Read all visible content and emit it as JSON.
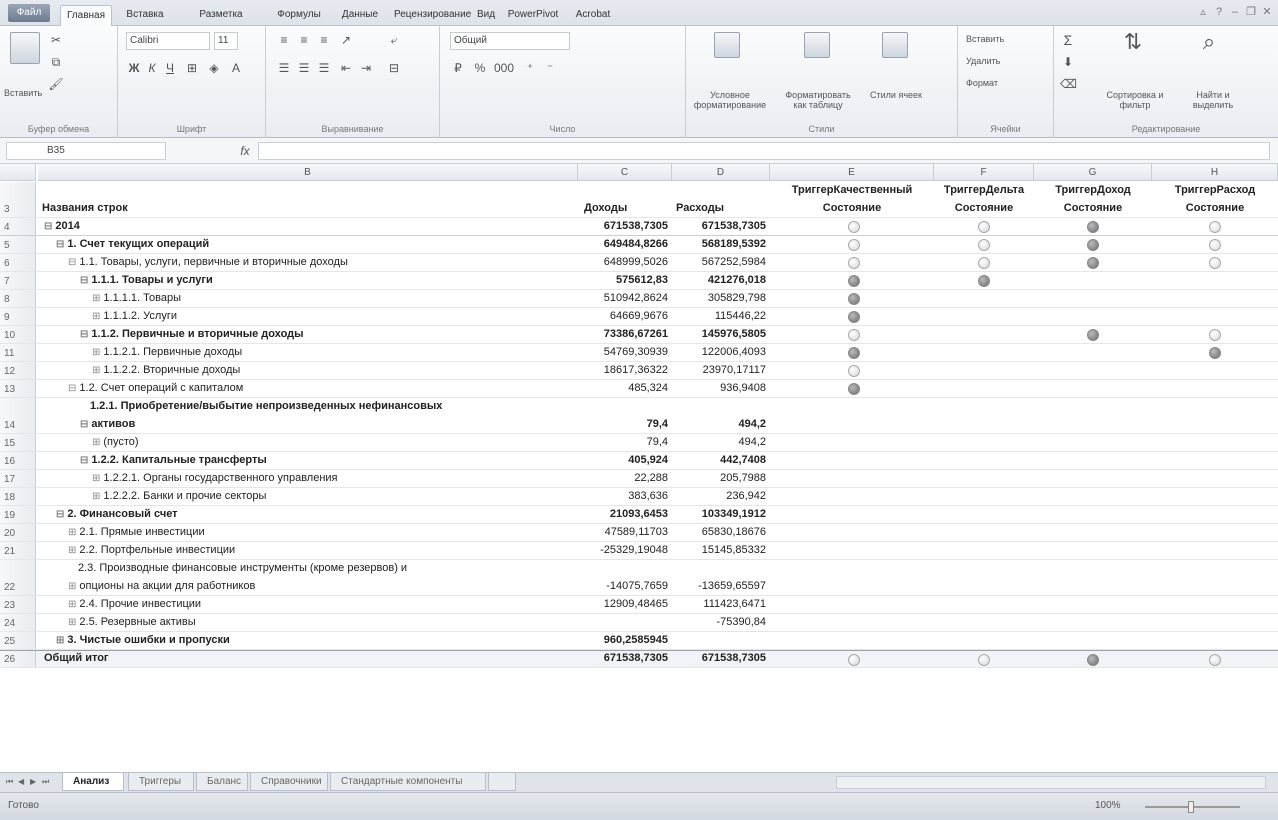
{
  "ribbon_tabs": [
    "Файл",
    "Главная",
    "Вставка",
    "Разметка страницы",
    "Формулы",
    "Данные",
    "Рецензирование",
    "Вид",
    "PowerPivot",
    "Acrobat"
  ],
  "ribbon": {
    "clipboard": {
      "paste": "Вставить",
      "label": "Буфер обмена"
    },
    "font": {
      "name": "Calibri",
      "size": "11",
      "label": "Шрифт"
    },
    "alignment": {
      "label": "Выравнивание"
    },
    "number": {
      "format": "Общий",
      "label": "Число"
    },
    "styles": {
      "conditional": "Условное форматирование",
      "table": "Форматировать как таблицу",
      "cell": "Стили ячеек",
      "label": "Стили"
    },
    "cells": {
      "insert": "Вставить",
      "delete": "Удалить",
      "format": "Формат",
      "label": "Ячейки"
    },
    "editing": {
      "sort": "Сортировка и фильтр",
      "find": "Найти и выделить",
      "label": "Редактирование"
    }
  },
  "formula_bar": {
    "name_box": "B35",
    "fx": "fx",
    "formula": ""
  },
  "columns": [
    "B",
    "C",
    "D",
    "E",
    "F",
    "G",
    "H"
  ],
  "header_row": {
    "num": "3",
    "title": "Названия строк",
    "c": "Доходы",
    "d": "Расходы",
    "e1": "ТриггерКачественный",
    "e2": "Состояние",
    "f1": "ТриггерДельта",
    "f2": "Состояние",
    "g1": "ТриггерДоход",
    "g2": "Состояние",
    "h1": "ТриггерРасход",
    "h2": "Состояние"
  },
  "rows": [
    {
      "num": "4",
      "level": 0,
      "toggle": "⊟",
      "label": "2014",
      "c": "671538,7305",
      "d": "671538,7305",
      "bold": true,
      "e": "light",
      "f": "light",
      "g": "dark",
      "h": "light"
    },
    {
      "num": "5",
      "level": 1,
      "toggle": "⊟",
      "label": "1. Счет текущих операций",
      "c": "649484,8266",
      "d": "568189,5392",
      "bold": true,
      "e": "light",
      "f": "light",
      "g": "dark",
      "h": "light"
    },
    {
      "num": "6",
      "level": 2,
      "toggle": "⊟",
      "label": "1.1. Товары, услуги, первичные и вторичные доходы",
      "c": "648999,5026",
      "d": "567252,5984",
      "bold": false,
      "e": "light",
      "f": "light",
      "g": "dark",
      "h": "light"
    },
    {
      "num": "7",
      "level": 3,
      "toggle": "⊟",
      "label": "1.1.1. Товары и услуги",
      "c": "575612,83",
      "d": "421276,018",
      "bold": true,
      "e": "dark",
      "f": "dark",
      "g": "",
      "h": ""
    },
    {
      "num": "8",
      "level": 4,
      "toggle": "⊞",
      "label": "1.1.1.1. Товары",
      "c": "510942,8624",
      "d": "305829,798",
      "bold": false,
      "e": "dark",
      "f": "",
      "g": "",
      "h": ""
    },
    {
      "num": "9",
      "level": 4,
      "toggle": "⊞",
      "label": "1.1.1.2. Услуги",
      "c": "64669,9676",
      "d": "115446,22",
      "bold": false,
      "e": "dark",
      "f": "",
      "g": "",
      "h": ""
    },
    {
      "num": "10",
      "level": 3,
      "toggle": "⊟",
      "label": "1.1.2. Первичные и вторичные доходы",
      "c": "73386,67261",
      "d": "145976,5805",
      "bold": true,
      "e": "light",
      "f": "",
      "g": "dark",
      "h": "light"
    },
    {
      "num": "11",
      "level": 4,
      "toggle": "⊞",
      "label": "1.1.2.1. Первичные доходы",
      "c": "54769,30939",
      "d": "122006,4093",
      "bold": false,
      "e": "dark",
      "f": "",
      "g": "",
      "h": "dark"
    },
    {
      "num": "12",
      "level": 4,
      "toggle": "⊞",
      "label": "1.1.2.2. Вторичные доходы",
      "c": "18617,36322",
      "d": "23970,17117",
      "bold": false,
      "e": "light",
      "f": "",
      "g": "",
      "h": ""
    },
    {
      "num": "13",
      "level": 2,
      "toggle": "⊟",
      "label": "1.2. Счет операций с капиталом",
      "c": "485,324",
      "d": "936,9408",
      "bold": false,
      "e": "dark",
      "f": "",
      "g": "",
      "h": ""
    },
    {
      "num": "14",
      "level": 3,
      "toggle": "⊟",
      "label": "1.2.1. Приобретение/выбытие непроизведенных нефинансовых",
      "label2": "активов",
      "c": "79,4",
      "d": "494,2",
      "bold": true,
      "tall": true,
      "e": "",
      "f": "",
      "g": "",
      "h": ""
    },
    {
      "num": "15",
      "level": 4,
      "toggle": "⊞",
      "label": "(пусто)",
      "c": "79,4",
      "d": "494,2",
      "bold": false,
      "e": "",
      "f": "",
      "g": "",
      "h": ""
    },
    {
      "num": "16",
      "level": 3,
      "toggle": "⊟",
      "label": "1.2.2. Капитальные трансферты",
      "c": "405,924",
      "d": "442,7408",
      "bold": true,
      "e": "",
      "f": "",
      "g": "",
      "h": ""
    },
    {
      "num": "17",
      "level": 4,
      "toggle": "⊞",
      "label": "1.2.2.1. Органы государственного управления",
      "c": "22,288",
      "d": "205,7988",
      "bold": false,
      "e": "",
      "f": "",
      "g": "",
      "h": ""
    },
    {
      "num": "18",
      "level": 4,
      "toggle": "⊞",
      "label": "1.2.2.2. Банки и прочие секторы",
      "c": "383,636",
      "d": "236,942",
      "bold": false,
      "e": "",
      "f": "",
      "g": "",
      "h": ""
    },
    {
      "num": "19",
      "level": 1,
      "toggle": "⊟",
      "label": "2. Финансовый счет",
      "c": "21093,6453",
      "d": "103349,1912",
      "bold": true,
      "e": "",
      "f": "",
      "g": "",
      "h": ""
    },
    {
      "num": "20",
      "level": 2,
      "toggle": "⊞",
      "label": "2.1. Прямые инвестиции",
      "c": "47589,11703",
      "d": "65830,18676",
      "bold": false,
      "e": "",
      "f": "",
      "g": "",
      "h": ""
    },
    {
      "num": "21",
      "level": 2,
      "toggle": "⊞",
      "label": "2.2. Портфельные инвестиции",
      "c": "-25329,19048",
      "d": "15145,85332",
      "bold": false,
      "e": "",
      "f": "",
      "g": "",
      "h": ""
    },
    {
      "num": "22",
      "level": 2,
      "toggle": "⊞",
      "label": "2.3. Производные финансовые инструменты (кроме резервов) и",
      "label2": "опционы на акции для работников",
      "c": "-14075,7659",
      "d": "-13659,65597",
      "bold": false,
      "tall": true,
      "e": "",
      "f": "",
      "g": "",
      "h": ""
    },
    {
      "num": "23",
      "level": 2,
      "toggle": "⊞",
      "label": "2.4. Прочие инвестиции",
      "c": "12909,48465",
      "d": "111423,6471",
      "bold": false,
      "e": "",
      "f": "",
      "g": "",
      "h": ""
    },
    {
      "num": "24",
      "level": 2,
      "toggle": "⊞",
      "label": "2.5. Резервные активы",
      "c": "",
      "d": "-75390,84",
      "bold": false,
      "e": "",
      "f": "",
      "g": "",
      "h": ""
    },
    {
      "num": "25",
      "level": 1,
      "toggle": "⊞",
      "label": "3. Чистые ошибки и пропуски",
      "c": "960,2585945",
      "d": "",
      "bold": true,
      "e": "",
      "f": "",
      "g": "",
      "h": ""
    },
    {
      "num": "26",
      "level": 0,
      "toggle": "",
      "label": "Общий итог",
      "c": "671538,7305",
      "d": "671538,7305",
      "bold": true,
      "total": true,
      "e": "light",
      "f": "light",
      "g": "dark",
      "h": "light"
    }
  ],
  "sheet_tabs": [
    "Анализ",
    "Триггеры",
    "Баланс",
    "Справочники",
    "Стандартные компоненты"
  ],
  "status": {
    "ready": "Готово",
    "zoom": "100%"
  }
}
